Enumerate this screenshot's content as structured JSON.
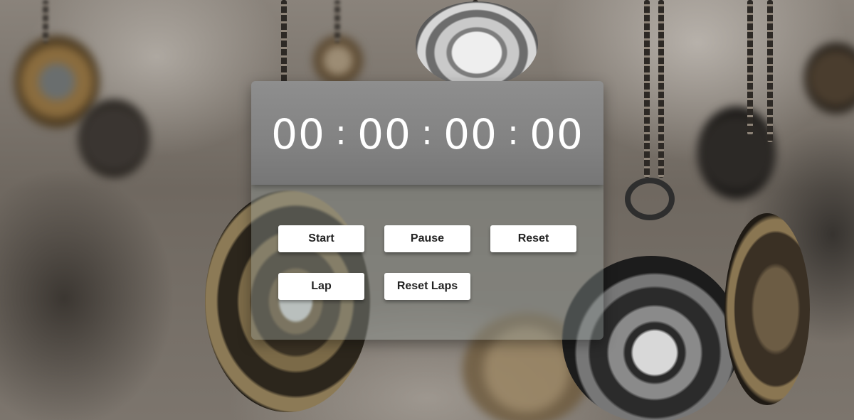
{
  "stopwatch": {
    "hours": "00",
    "minutes": "00",
    "seconds": "00",
    "centiseconds": "00",
    "separator": ":"
  },
  "buttons": {
    "start": "Start",
    "pause": "Pause",
    "reset": "Reset",
    "lap": "Lap",
    "reset_laps": "Reset Laps"
  },
  "background": {
    "description_icon": "pocket-watch-icon"
  }
}
